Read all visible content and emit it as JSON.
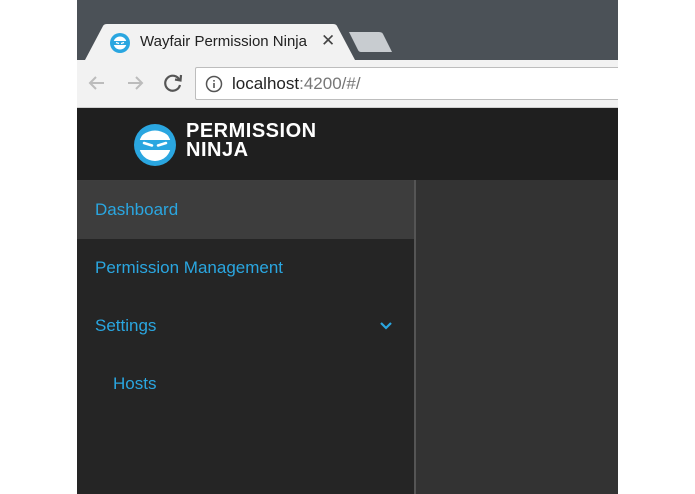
{
  "browser": {
    "tab_title": "Wayfair Permission Ninja",
    "close_glyph": "✕",
    "url_host": "localhost",
    "url_rest": ":4200/#/"
  },
  "app": {
    "logo_line1": "PERMISSION",
    "logo_line2": "NINJA"
  },
  "sidebar": {
    "items": [
      {
        "label": "Dashboard",
        "active": true
      },
      {
        "label": "Permission Management",
        "active": false
      },
      {
        "label": "Settings",
        "active": false,
        "icon": "chevron-down-icon"
      },
      {
        "label": "Hosts",
        "active": false,
        "sub": true
      }
    ]
  },
  "colors": {
    "accent": "#2aa6e0",
    "header": "#1f1f1f",
    "sidebar": "#252525",
    "main": "#333333",
    "tabstrip": "#4b5157"
  }
}
